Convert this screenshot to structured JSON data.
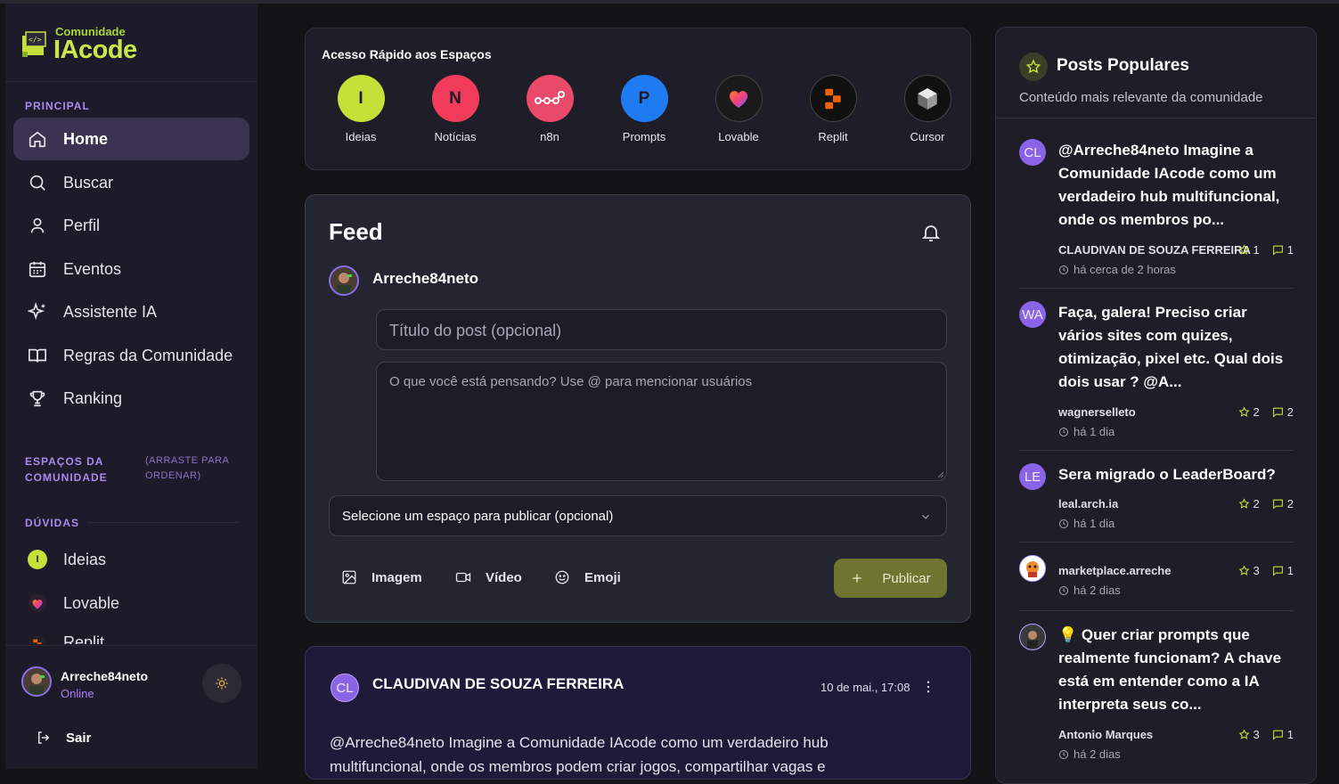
{
  "brand": {
    "small": "Comunidade",
    "big": "IAcode"
  },
  "sidebar": {
    "principal_label": "PRINCIPAL",
    "items": [
      {
        "label": "Home",
        "icon": "home-icon",
        "active": true
      },
      {
        "label": "Buscar",
        "icon": "search-icon"
      },
      {
        "label": "Perfil",
        "icon": "user-icon"
      },
      {
        "label": "Eventos",
        "icon": "calendar-icon"
      },
      {
        "label": "Assistente IA",
        "icon": "sparkles-icon"
      },
      {
        "label": "Regras da Comunidade",
        "icon": "book-icon"
      },
      {
        "label": "Ranking",
        "icon": "trophy-icon"
      }
    ],
    "spaces_label": "ESPAÇOS DA COMUNIDADE",
    "spaces_hint": "(ARRASTE PARA ORDENAR)",
    "duvidas_label": "DÚVIDAS",
    "spaces": [
      {
        "label": "Ideias",
        "letter": "I",
        "color": "#c6e03a"
      },
      {
        "label": "Lovable",
        "letter": "",
        "color": "#2a2030"
      },
      {
        "label": "Replit",
        "letter": "",
        "color": "#222"
      }
    ],
    "user": {
      "name": "Arreche84neto",
      "status": "Online"
    },
    "logout": "Sair"
  },
  "quick": {
    "title": "Acesso Rápido aos Espaços",
    "items": [
      {
        "name": "Ideias",
        "letter": "I",
        "bg": "#c6e03a",
        "fg": "#1d1b2a"
      },
      {
        "name": "Notícias",
        "letter": "N",
        "bg": "#f03c5a",
        "fg": "#1d1b2a"
      },
      {
        "name": "n8n",
        "letter": "",
        "bg": "#e94a6a",
        "fg": "#ffffff"
      },
      {
        "name": "Prompts",
        "letter": "P",
        "bg": "#1f7bf2",
        "fg": "#1d1b2a"
      },
      {
        "name": "Lovable",
        "letter": "",
        "bg": "#1a1a1a",
        "fg": "#ffffff"
      },
      {
        "name": "Replit",
        "letter": "",
        "bg": "#111111",
        "fg": "#ffffff"
      },
      {
        "name": "Cursor",
        "letter": "",
        "bg": "#111111",
        "fg": "#ffffff"
      }
    ]
  },
  "feed": {
    "title": "Feed",
    "user": "Arreche84neto",
    "title_placeholder": "Título do post (opcional)",
    "body_placeholder": "O que você está pensando? Use @ para mencionar usuários",
    "space_select": "Selecione um espaço para publicar (opcional)",
    "tools": {
      "image": "Imagem",
      "video": "Vídeo",
      "emoji": "Emoji"
    },
    "publish": "Publicar"
  },
  "post": {
    "initials": "CL",
    "author": "CLAUDIVAN DE SOUZA FERREIRA",
    "date": "10 de mai., 17:08",
    "line1": "@Arreche84neto Imagine a Comunidade IAcode como um verdadeiro hub",
    "line2": "multifuncional, onde os membros podem criar jogos, compartilhar vagas e"
  },
  "popular": {
    "title": "Posts Populares",
    "subtitle": "Conteúdo mais relevante da comunidade",
    "items": [
      {
        "initials": "CL",
        "title": "@Arreche84neto Imagine a Comunidade IAcode como um verdadeiro hub multifuncional, onde os membros po...",
        "author": "CLAUDIVAN DE SOUZA FERREIRA",
        "stars": "1",
        "comments": "1",
        "time": "há cerca de 2 horas"
      },
      {
        "initials": "WA",
        "title": "Faça, galera! Preciso criar vários sites com quizes, otimização, pixel etc. Qual dois dois usar ? @A...",
        "author": "wagnerselleto",
        "stars": "2",
        "comments": "2",
        "time": "há 1 dia"
      },
      {
        "initials": "LE",
        "title": "Sera migrado o LeaderBoard?",
        "author": "leal.arch.ia",
        "stars": "2",
        "comments": "2",
        "time": "há 1 dia"
      },
      {
        "initials": "",
        "title": "",
        "author": "marketplace.arreche",
        "stars": "3",
        "comments": "1",
        "time": "há 2 dias"
      },
      {
        "initials": "",
        "title": "💡 Quer criar prompts que realmente funcionam? A chave está em entender como a IA interpreta seus co...",
        "author": "Antonio Marques",
        "stars": "3",
        "comments": "1",
        "time": "há 2 dias"
      }
    ]
  },
  "colors": {
    "accent_purple": "#a98bf0",
    "lime": "#c6e03a",
    "publish": "#6f7530"
  }
}
